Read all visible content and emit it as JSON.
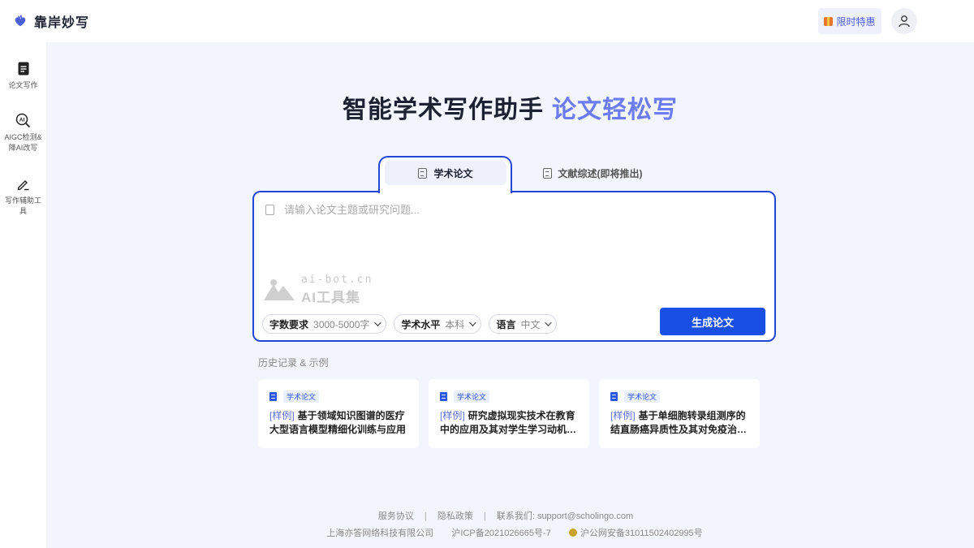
{
  "header": {
    "brand": "靠岸妙写",
    "promo_label": "限时特惠",
    "icons": {
      "logo": "brand-heart-icon",
      "user": "user-icon",
      "gift": "gift-icon"
    }
  },
  "sidebar": {
    "items": [
      {
        "label": "论文写作",
        "icon": "document-icon"
      },
      {
        "label": "AIGC检测&降AI改写",
        "icon": "ai-search-icon"
      },
      {
        "label": "写作辅助工具",
        "icon": "pen-icon"
      }
    ]
  },
  "hero": {
    "title": "智能学术写作助手",
    "title_accent": "论文轻松写"
  },
  "tabs": [
    {
      "label": "学术论文",
      "active": true
    },
    {
      "label": "文献综述(即将推出)",
      "active": false
    }
  ],
  "editor": {
    "placeholder": "请输入论文主题或研究问题...",
    "options": [
      {
        "key": "字数要求",
        "value": "3000-5000字"
      },
      {
        "key": "学术水平",
        "value": "本科"
      },
      {
        "key": "语言",
        "value": "中文"
      }
    ],
    "generate_label": "生成论文"
  },
  "watermark": {
    "url": "ai-bot.cn",
    "name": "AI工具集"
  },
  "history": {
    "title": "历史记录 & 示例",
    "cards": [
      {
        "tag": "学术论文",
        "prefix": "[样例]",
        "text": "基于领域知识图谱的医疗大型语言模型精细化训练与应用"
      },
      {
        "tag": "学术论文",
        "prefix": "[样例]",
        "text": "研究虚拟现实技术在教育中的应用及其对学生学习动机和效果的影响"
      },
      {
        "tag": "学术论文",
        "prefix": "[样例]",
        "text": "基于单细胞转录组测序的结直肠癌异质性及其对免疫治疗反应的影响"
      }
    ]
  },
  "footer": {
    "links": [
      "服务协议",
      "隐私政策"
    ],
    "contact": "联系我们: support@scholingo.com",
    "company": "上海亦答网络科技有限公司",
    "icp": "沪ICP备2021026665号-7",
    "police": "沪公网安备31011502402995号"
  },
  "colors": {
    "accent": "#1a4fe6",
    "accent_light": "#6b7cf0",
    "background": "#f3f5fc"
  }
}
